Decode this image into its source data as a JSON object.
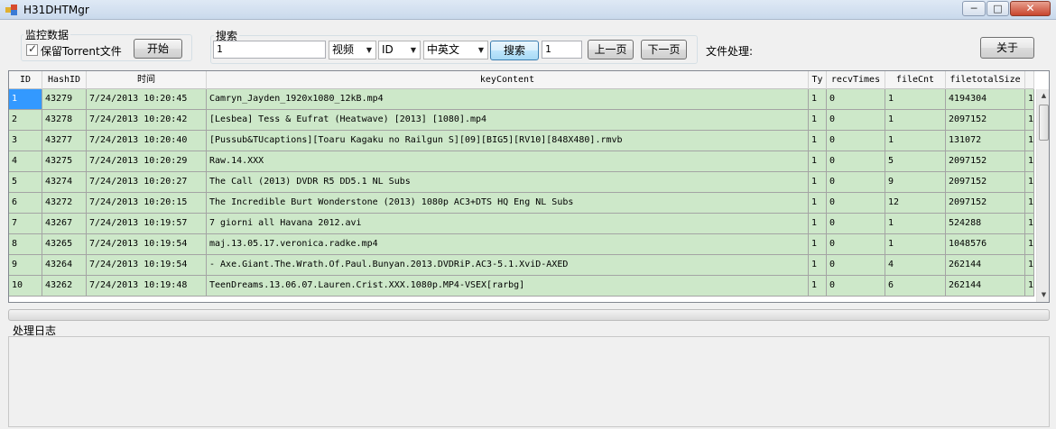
{
  "window": {
    "title": "H31DHTMgr",
    "minimize_glyph": "─",
    "maximize_glyph": "□",
    "close_glyph": "✕"
  },
  "monitor": {
    "group_label": "监控数据",
    "keep_torrent_label": "保留Torrent文件",
    "keep_torrent_checked": true,
    "start_button": "开始"
  },
  "search": {
    "group_label": "搜索",
    "query_value": "1",
    "type_combo": "视频",
    "field_combo": "ID",
    "language_combo": "中英文",
    "search_button": "搜索",
    "page_value": "1",
    "prev_page_button": "上一页",
    "next_page_button": "下一页"
  },
  "file_processing_label": "文件处理:",
  "close_button": "关于",
  "grid": {
    "columns": [
      "ID",
      "HashID",
      "时间",
      "keyContent",
      "Ty",
      "recvTimes",
      "fileCnt",
      "filetotalSize"
    ],
    "rows": [
      [
        "1",
        "43279",
        "7/24/2013 10:20:45",
        "Camryn_Jayden_1920x1080_12kB.mp4",
        "1",
        "0",
        "1",
        "4194304",
        "1"
      ],
      [
        "2",
        "43278",
        "7/24/2013 10:20:42",
        "[Lesbea] Tess & Eufrat (Heatwave) [2013] [1080].mp4",
        "1",
        "0",
        "1",
        "2097152",
        "1"
      ],
      [
        "3",
        "43277",
        "7/24/2013 10:20:40",
        "[Pussub&TUcaptions][Toaru Kagaku no Railgun S][09][BIG5][RV10][848X480].rmvb",
        "1",
        "0",
        "1",
        "131072",
        "1"
      ],
      [
        "4",
        "43275",
        "7/24/2013 10:20:29",
        "Raw.14.XXX",
        "1",
        "0",
        "5",
        "2097152",
        "1"
      ],
      [
        "5",
        "43274",
        "7/24/2013 10:20:27",
        "The Call (2013) DVDR R5 DD5.1 NL Subs",
        "1",
        "0",
        "9",
        "2097152",
        "1"
      ],
      [
        "6",
        "43272",
        "7/24/2013 10:20:15",
        "The Incredible Burt Wonderstone (2013) 1080p AC3+DTS HQ Eng NL Subs",
        "1",
        "0",
        "12",
        "2097152",
        "1"
      ],
      [
        "7",
        "43267",
        "7/24/2013 10:19:57",
        "7 giorni all Havana 2012.avi",
        "1",
        "0",
        "1",
        "524288",
        "1"
      ],
      [
        "8",
        "43265",
        "7/24/2013 10:19:54",
        "maj.13.05.17.veronica.radke.mp4",
        "1",
        "0",
        "1",
        "1048576",
        "1"
      ],
      [
        "9",
        "43264",
        "7/24/2013 10:19:54",
        "- Axe.Giant.The.Wrath.Of.Paul.Bunyan.2013.DVDRiP.AC3-5.1.XviD-AXED",
        "1",
        "0",
        "4",
        "262144",
        "1"
      ],
      [
        "10",
        "43262",
        "7/24/2013 10:19:48",
        "TeenDreams.13.06.07.Lauren.Crist.XXX.1080p.MP4-VSEX[rarbg]",
        "1",
        "0",
        "6",
        "262144",
        "1"
      ]
    ],
    "scroll_up_glyph": "▲",
    "scroll_down_glyph": "▼"
  },
  "log_label": "处理日志",
  "colors": {
    "row_background": "#cde8c9",
    "selected_cell": "#3399ff"
  }
}
